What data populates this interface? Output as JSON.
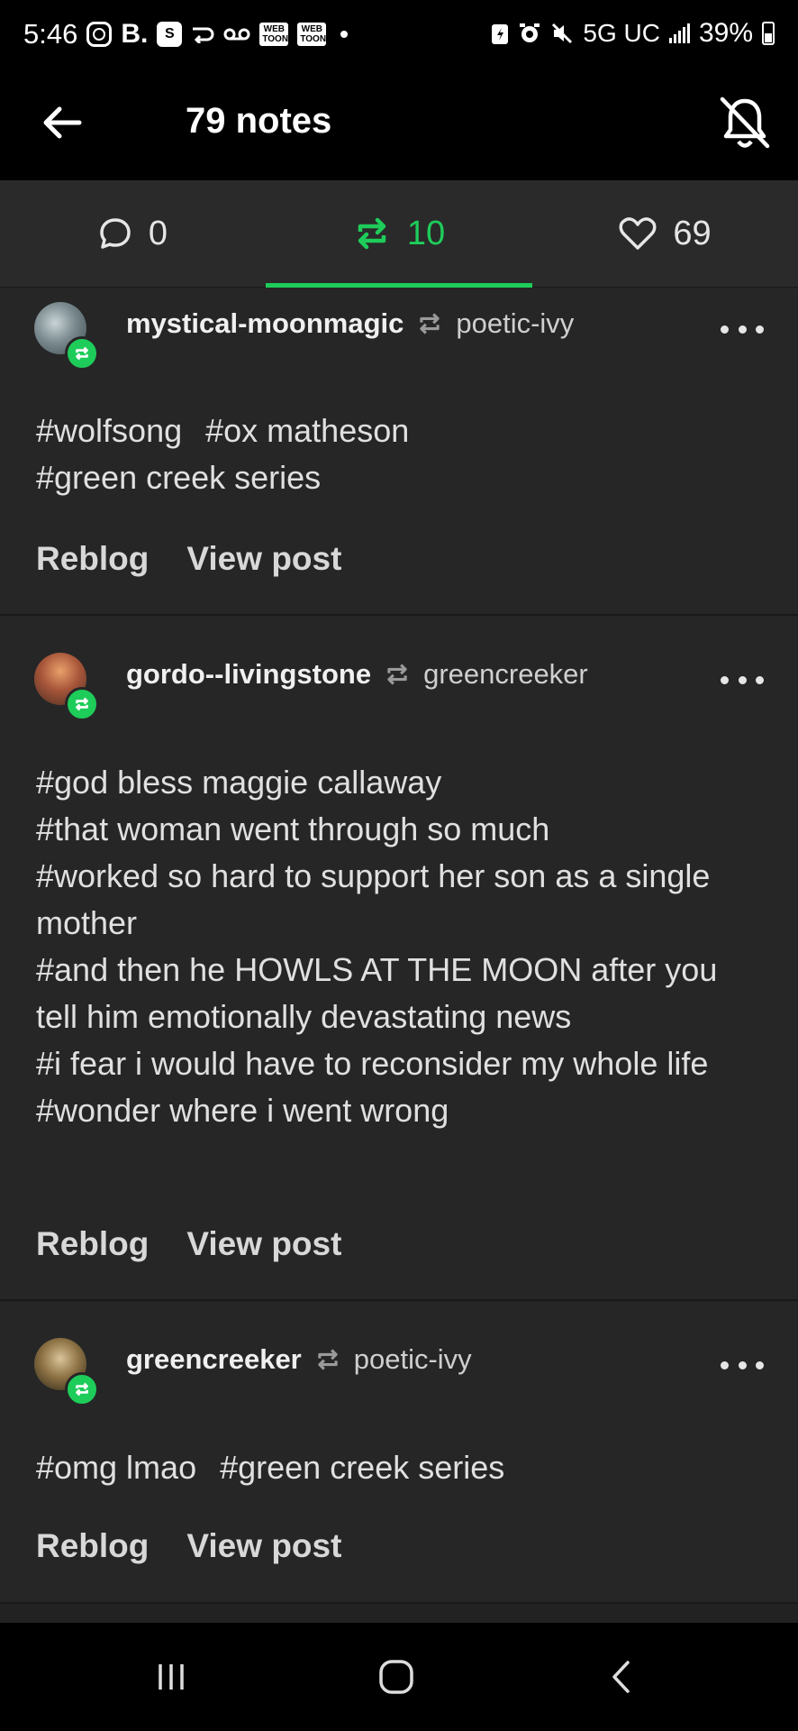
{
  "status_bar": {
    "time": "5:46",
    "left_icons": [
      "instagram-icon",
      "b-app-icon",
      "s-app-icon",
      "route-icon",
      "voicemail-icon",
      "webtoon-icon",
      "webtoon-icon",
      "dot-icon"
    ],
    "webtoon_label": "WEB TOON",
    "b_label": "B.",
    "s_label": "S",
    "network": "5G UC",
    "battery": "39%"
  },
  "header": {
    "title": "79 notes"
  },
  "tabs": [
    {
      "label": "0",
      "icon": "comment-icon"
    },
    {
      "label": "10",
      "icon": "reblog-icon",
      "active": true
    },
    {
      "label": "69",
      "icon": "heart-icon"
    }
  ],
  "notes": [
    {
      "blog": "mystical-moonmagic",
      "source": "poetic-ivy",
      "tag_rows": [
        [
          "#wolfsong",
          "#ox matheson"
        ],
        [
          "#green creek series"
        ]
      ],
      "reblog_label": "Reblog",
      "view_label": "View post"
    },
    {
      "blog": "gordo--livingstone",
      "source": "greencreeker",
      "tag_rows": [
        [
          "#god bless maggie callaway"
        ],
        [
          "#that woman went through so much"
        ],
        [
          "#worked so hard to support her son as a single mother"
        ],
        [
          "#and then he HOWLS AT THE MOON after you tell him emotionally devastating news"
        ],
        [
          "#i fear i would have to reconsider my whole life"
        ],
        [
          "#wonder where i went wrong"
        ]
      ],
      "reblog_label": "Reblog",
      "view_label": "View post"
    },
    {
      "blog": "greencreeker",
      "source": "poetic-ivy",
      "tag_rows": [
        [
          "#omg lmao",
          "#green creek series"
        ]
      ],
      "reblog_label": "Reblog",
      "view_label": "View post"
    }
  ],
  "colors": {
    "accent": "#1ecc5a",
    "background": "#222222",
    "header": "#000000"
  }
}
